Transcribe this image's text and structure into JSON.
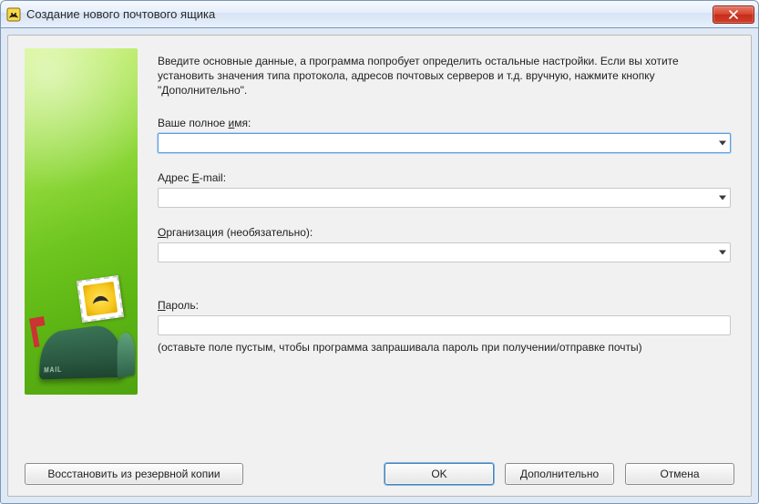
{
  "window": {
    "title": "Создание нового почтового ящика"
  },
  "intro": "Введите основные данные, а программа попробует определить остальные настройки. Если вы хотите установить значения типа протокола, адресов почтовых серверов и т.д. вручную, нажмите кнопку \"Дополнительно\".",
  "fields": {
    "name": {
      "label_prefix": "Ваше полное ",
      "label_ul": "и",
      "label_suffix": "мя:",
      "value": ""
    },
    "email": {
      "label_prefix": "Адрес ",
      "label_ul": "E",
      "label_suffix": "-mail:",
      "value": ""
    },
    "org": {
      "label_prefix": "",
      "label_ul": "О",
      "label_suffix": "рганизация (необязательно):",
      "value": ""
    },
    "password": {
      "label_prefix": "",
      "label_ul": "П",
      "label_suffix": "ароль:",
      "value": ""
    }
  },
  "password_hint": "(оставьте поле пустым, чтобы программа запрашивала пароль при получении/отправке почты)",
  "buttons": {
    "restore": "Восстановить из резервной копии",
    "ok": "OK",
    "more": "Дополнительно",
    "cancel": "Отмена"
  }
}
